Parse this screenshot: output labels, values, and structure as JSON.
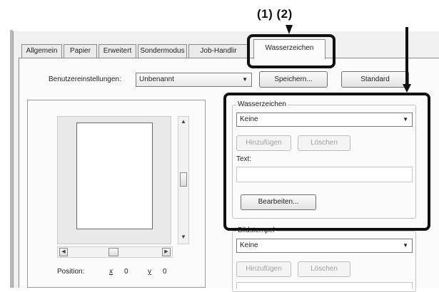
{
  "annotation": {
    "step_label": "(1) (2)"
  },
  "tabs": [
    {
      "label": "Allgemein"
    },
    {
      "label": "Papier"
    },
    {
      "label": "Erweitert"
    },
    {
      "label": "Sondermodus"
    },
    {
      "label": "Job-Handlir"
    },
    {
      "label": "Wasserzeichen",
      "active": true
    }
  ],
  "settings": {
    "label": "Benutzereinstellungen:",
    "selected": "Unbenannt",
    "save_button": "Speichern...",
    "default_button": "Standard"
  },
  "preview": {
    "position_label": "Position:",
    "x_label": "x",
    "x_value": "0",
    "y_label": "y",
    "y_value": "0"
  },
  "watermark": {
    "group_title": "Wasserzeichen",
    "selected": "Keine",
    "add_button": "Hinzufügen",
    "delete_button": "Löschen",
    "text_label": "Text:",
    "text_value": "",
    "edit_button": "Bearbeiten..."
  },
  "image_stamp": {
    "group_title": "Bildstempel",
    "selected": "Keine",
    "add_button": "Hinzufügen",
    "delete_button": "Löschen"
  }
}
